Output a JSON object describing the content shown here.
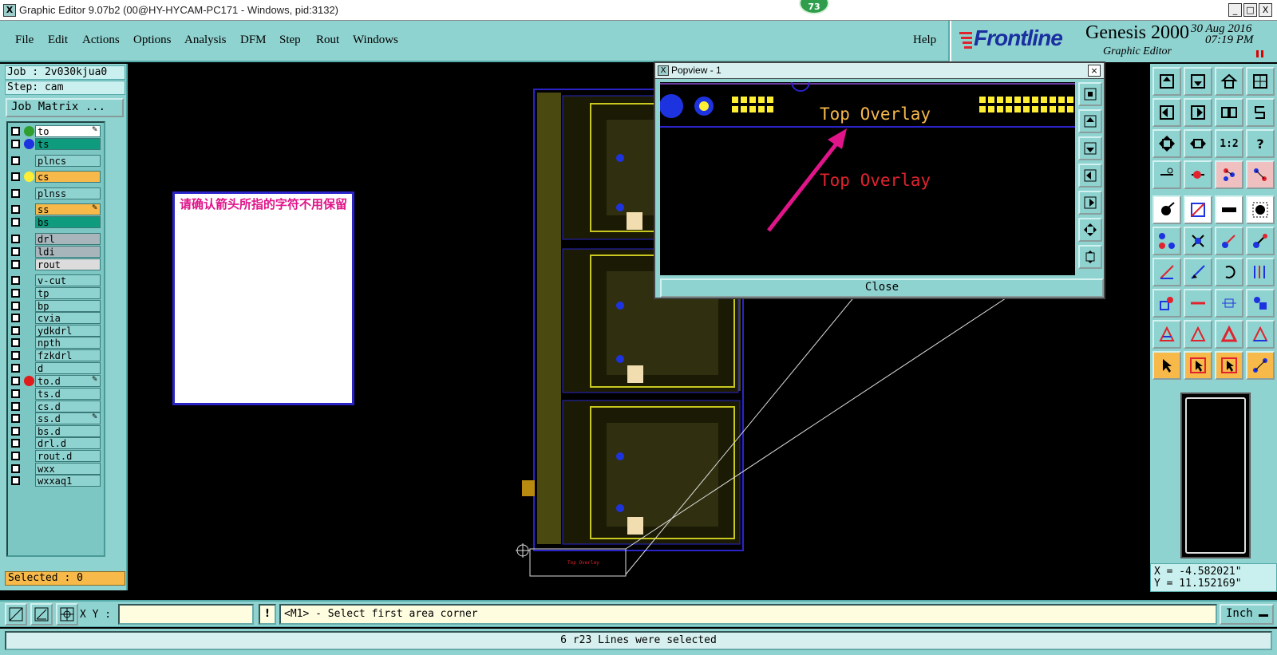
{
  "window": {
    "title": "Graphic Editor 9.07b2 (00@HY-HYCAM-PC171 - Windows, pid:3132)",
    "badge_count": "73",
    "min_glyph": "_",
    "max_glyph": "□",
    "close_glyph": "X"
  },
  "menu": {
    "file": "File",
    "edit": "Edit",
    "actions": "Actions",
    "options": "Options",
    "analysis": "Analysis",
    "dfm": "DFM",
    "step": "Step",
    "rout": "Rout",
    "windows": "Windows",
    "help": "Help"
  },
  "brand": {
    "name": "Frontline",
    "product": "Genesis 2000",
    "subtitle": "Graphic Editor",
    "date": "30 Aug 2016",
    "time": "07:19 PM"
  },
  "job": {
    "job_label": "Job : 2v030kjua0",
    "step_label": "Step: cam",
    "matrix_button": "Job Matrix ..."
  },
  "layers": [
    {
      "name": "to",
      "color": "#ffffff",
      "dot": "#2e9e2e",
      "edit": true
    },
    {
      "name": "ts",
      "color": "#0f9c7e",
      "dot": "#1e33e0",
      "edit": false
    },
    {
      "name": "plncs",
      "color": "#8fd3d0",
      "dot": "",
      "edit": false
    },
    {
      "name": "cs",
      "color": "#f6b94a",
      "dot": "#ffee33",
      "edit": false
    },
    {
      "name": "plnss",
      "color": "#8fd3d0",
      "dot": "",
      "edit": false
    },
    {
      "name": "ss",
      "color": "#f6b94a",
      "dot": "",
      "edit": true
    },
    {
      "name": "bs",
      "color": "#0f9c7e",
      "dot": "",
      "edit": false
    },
    {
      "name": "drl",
      "color": "#a8b6bc",
      "dot": "",
      "edit": false
    },
    {
      "name": "ldi",
      "color": "#a8b6bc",
      "dot": "",
      "edit": false
    },
    {
      "name": "rout",
      "color": "#dcdcdc",
      "dot": "",
      "edit": false
    },
    {
      "name": "v-cut",
      "color": "#8fd3d0",
      "dot": "",
      "edit": false
    },
    {
      "name": "tp",
      "color": "#8fd3d0",
      "dot": "",
      "edit": false
    },
    {
      "name": "bp",
      "color": "#8fd3d0",
      "dot": "",
      "edit": false
    },
    {
      "name": "cvia",
      "color": "#8fd3d0",
      "dot": "",
      "edit": false
    },
    {
      "name": "ydkdrl",
      "color": "#8fd3d0",
      "dot": "",
      "edit": false
    },
    {
      "name": "npth",
      "color": "#8fd3d0",
      "dot": "",
      "edit": false
    },
    {
      "name": "fzkdrl",
      "color": "#8fd3d0",
      "dot": "",
      "edit": false
    },
    {
      "name": "d",
      "color": "#8fd3d0",
      "dot": "",
      "edit": false
    },
    {
      "name": "to.d",
      "color": "#8fd3d0",
      "dot": "#e01b1b",
      "edit": true
    },
    {
      "name": "ts.d",
      "color": "#8fd3d0",
      "dot": "",
      "edit": false
    },
    {
      "name": "cs.d",
      "color": "#8fd3d0",
      "dot": "",
      "edit": false
    },
    {
      "name": "ss.d",
      "color": "#8fd3d0",
      "dot": "",
      "edit": true
    },
    {
      "name": "bs.d",
      "color": "#8fd3d0",
      "dot": "",
      "edit": false
    },
    {
      "name": "drl.d",
      "color": "#8fd3d0",
      "dot": "",
      "edit": false
    },
    {
      "name": "rout.d",
      "color": "#8fd3d0",
      "dot": "",
      "edit": false
    },
    {
      "name": "wxx",
      "color": "#8fd3d0",
      "dot": "",
      "edit": false
    },
    {
      "name": "wxxaq1",
      "color": "#8fd3d0",
      "dot": "",
      "edit": false
    }
  ],
  "selected": "Selected : 0",
  "note": {
    "text": "请确认箭头所指的字符不用保留"
  },
  "canvas": {
    "small_label": "Top Overlay"
  },
  "popview": {
    "title": "Popview - 1",
    "label_top": "Top Overlay",
    "label_red": "Top Overlay",
    "close_label": "Close"
  },
  "toolbox": {
    "ratio_label": "1:2",
    "help_label": "?"
  },
  "coords": {
    "x": "X = -4.582021\"",
    "y": "Y = 11.152169\""
  },
  "command": {
    "xy_label": "X Y :",
    "xy_value": "",
    "warn": "!",
    "prompt": "<M1> - Select first area corner",
    "unit": "Inch"
  },
  "status": {
    "text": "6 r23 Lines were selected"
  },
  "colors": {
    "panel": "#8fd3d0",
    "highlight": "#f6b94a",
    "accent": "#e0158a",
    "brand": "#1a2fa0"
  }
}
